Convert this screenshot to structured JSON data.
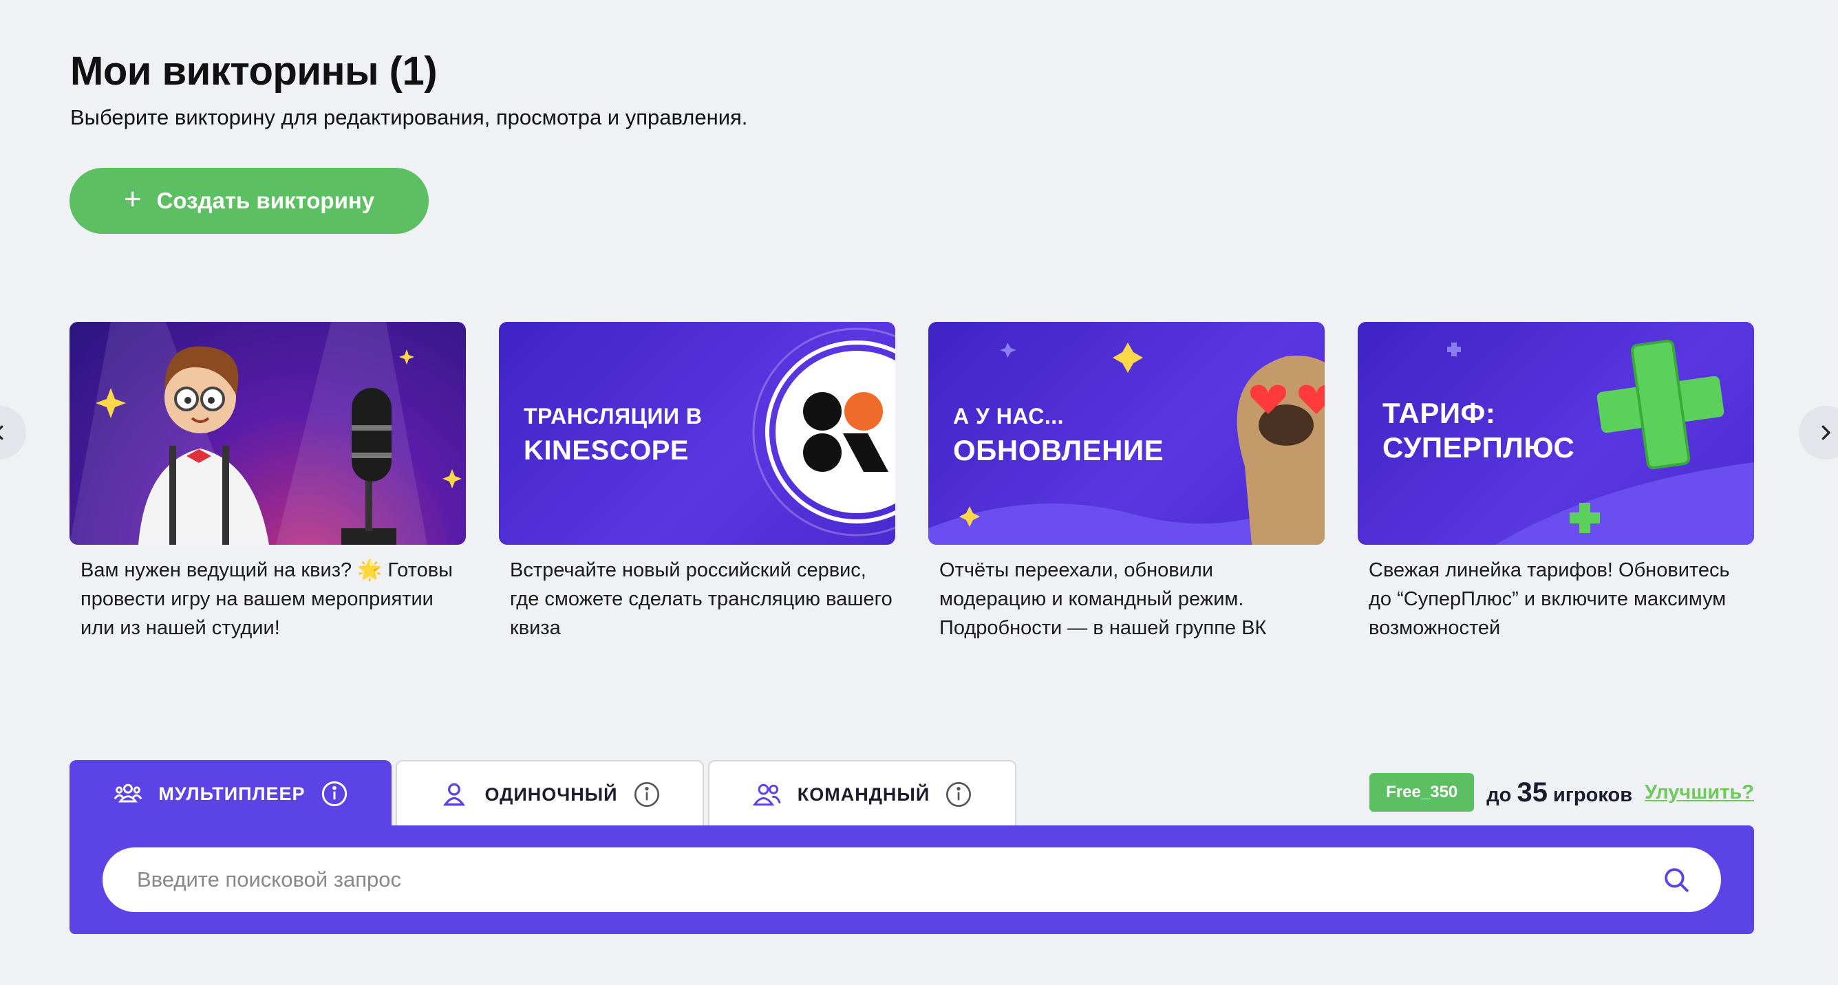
{
  "header": {
    "title": "Мои викторины (1)",
    "subtitle": "Выберите викторину для редактирования, просмотра и управления."
  },
  "create_button": {
    "label": "Создать викторину",
    "icon": "plus-icon"
  },
  "carousel": {
    "cards": [
      {
        "banner_title": "",
        "caption": "Вам нужен ведущий на квиз? 🌟 Готовы провести игру на вашем мероприятии или из нашей студии!"
      },
      {
        "banner_title": "ТРАНСЛЯЦИИ В KINESCOPE",
        "caption": "Встречайте новый российский сервис, где сможете сделать трансляцию вашего квиза"
      },
      {
        "banner_title": "А У НАС... ОБНОВЛЕНИЕ",
        "caption": "Отчёты переехали, обновили модерацию и командный режим. Подробности — в нашей группе ВК"
      },
      {
        "banner_title": "ТАРИФ: СУПЕРПЛЮС",
        "caption": "Свежая линейка тарифов! Обновитесь до “СуперПлюс” и включите максимум возможностей"
      }
    ]
  },
  "tabs": [
    {
      "label": "МУЛЬТИПЛЕЕР",
      "icon": "users-group-icon",
      "active": true
    },
    {
      "label": "ОДИНОЧНЫЙ",
      "icon": "user-icon",
      "active": false
    },
    {
      "label": "КОМАНДНЫЙ",
      "icon": "team-icon",
      "active": false
    }
  ],
  "plan": {
    "badge": "Free_350",
    "prefix": "до",
    "count": "35",
    "suffix": "игроков",
    "upgrade_label": "Улучшить?"
  },
  "search": {
    "placeholder": "Введите поисковой запрос",
    "value": ""
  },
  "colors": {
    "accent": "#5b43e6",
    "green": "#5cbf62",
    "background": "#f0f1f4"
  }
}
